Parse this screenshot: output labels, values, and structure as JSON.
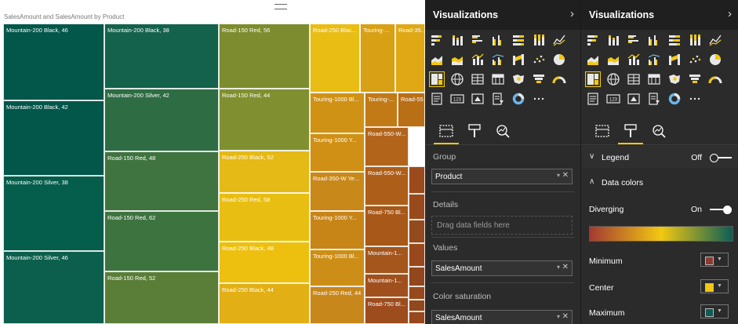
{
  "report": {
    "title": "SalesAmount and SalesAmount by Product"
  },
  "treemap": {
    "tiles": [
      {
        "label": "Mountain-200 Black, 46",
        "color": "#02564a"
      },
      {
        "label": "Mountain-200 Black, 42",
        "color": "#02564a"
      },
      {
        "label": "Mountain-200 Silver, 38",
        "color": "#055d4b"
      },
      {
        "label": "Mountain-200 Silver, 46",
        "color": "#0b5f4c"
      },
      {
        "label": "Mountain-200 Black, 38",
        "color": "#14624b"
      },
      {
        "label": "Mountain-200 Silver, 42",
        "color": "#2e6c43"
      },
      {
        "label": "Road-150 Red, 48",
        "color": "#3f733f"
      },
      {
        "label": "Road-150 Red, 62",
        "color": "#3d733f"
      },
      {
        "label": "Road-150 Red, 52",
        "color": "#5a7e37"
      },
      {
        "label": "Road-150 Red, 56",
        "color": "#7d8c2e"
      },
      {
        "label": "Road-150 Red, 44",
        "color": "#809030"
      },
      {
        "label": "Road-250 Black, 52",
        "color": "#e5b916"
      },
      {
        "label": "Road-250 Red, 58",
        "color": "#e9be12"
      },
      {
        "label": "Road-250 Black, 48",
        "color": "#edc010"
      },
      {
        "label": "Road-250 Black, 44",
        "color": "#e2b014"
      },
      {
        "label": "Road-250 Blac...",
        "color": "#e9bd14"
      },
      {
        "label": "Touring-...",
        "color": "#d8a015"
      },
      {
        "label": "Road-35...",
        "color": "#dfa814"
      },
      {
        "label": "Touring-1000 Bl...",
        "color": "#d09215"
      },
      {
        "label": "Touring-...",
        "color": "#c27a16"
      },
      {
        "label": "Road-55",
        "color": "#b96f16"
      },
      {
        "label": "Touring-1000 Y...",
        "color": "#cf9015"
      },
      {
        "label": "Road-550-W...",
        "color": "#b2651a"
      },
      {
        "label": "Road-350-W Ye...",
        "color": "#c9881a"
      },
      {
        "label": "Road-550-W...",
        "color": "#ad5f1a"
      },
      {
        "label": "Touring-1000 Y...",
        "color": "#c78518"
      },
      {
        "label": "Road-750 Bl...",
        "color": "#a85818"
      },
      {
        "label": "Touring-1000 Bl...",
        "color": "#cc8e17"
      },
      {
        "label": "Mountain-1...",
        "color": "#a4561d"
      },
      {
        "label": "Mountain-1...",
        "color": "#a0501d"
      },
      {
        "label": "Road-250 Red, 44",
        "color": "#c8871b"
      },
      {
        "label": "Road-750 Bl...",
        "color": "#9d4c1d"
      },
      {
        "label": "",
        "color": "#9a4a1d"
      },
      {
        "label": "",
        "color": "#984a1d"
      },
      {
        "label": "",
        "color": "#954a1d"
      },
      {
        "label": "",
        "color": "#98481c"
      },
      {
        "label": "",
        "color": "#92461d"
      },
      {
        "label": "",
        "color": "#96491d"
      },
      {
        "label": "",
        "color": "#93471d"
      },
      {
        "label": "",
        "color": "#97481d"
      }
    ]
  },
  "visualizations_pane": {
    "title": "Visualizations",
    "selected_icon": "treemap-icon",
    "icons": [
      "stacked-bar-icon",
      "stacked-column-icon",
      "clustered-bar-icon",
      "clustered-column-icon",
      "100-bar-icon",
      "100-column-icon",
      "line-chart-icon",
      "area-chart-icon",
      "stacked-area-icon",
      "line-column-icon",
      "line-clustered-icon",
      "ribbon-chart-icon",
      "scatter-icon",
      "pie-chart-icon",
      "treemap-icon",
      "map-icon",
      "table-icon",
      "matrix-icon",
      "filled-map-icon",
      "funnel-icon",
      "gauge-icon",
      "multirow-card-icon",
      "card-icon",
      "kpi-icon",
      "slicer-icon",
      "donut-icon",
      "more-icon"
    ],
    "tabs": [
      "fields-tab-icon",
      "format-tab-icon",
      "analytics-tab-icon"
    ],
    "active_tab": "fields",
    "group_label": "Group",
    "group_value": "Product",
    "details_label": "Details",
    "details_placeholder": "Drag data fields here",
    "values_label": "Values",
    "values_value": "SalesAmount",
    "color_saturation_label": "Color saturation",
    "color_saturation_value": "SalesAmount"
  },
  "format_pane": {
    "title": "Visualizations",
    "active_tab": "format",
    "legend_label": "Legend",
    "legend_state": "Off",
    "data_colors_label": "Data colors",
    "diverging_label": "Diverging",
    "diverging_state": "On",
    "gradient_colors": [
      "#a33a33",
      "#f2c811",
      "#0b5e55"
    ],
    "minimum_label": "Minimum",
    "minimum_color": "#8c3b32",
    "center_label": "Center",
    "center_color": "#f2c811",
    "maximum_label": "Maximum",
    "maximum_color": "#0e5c55"
  }
}
